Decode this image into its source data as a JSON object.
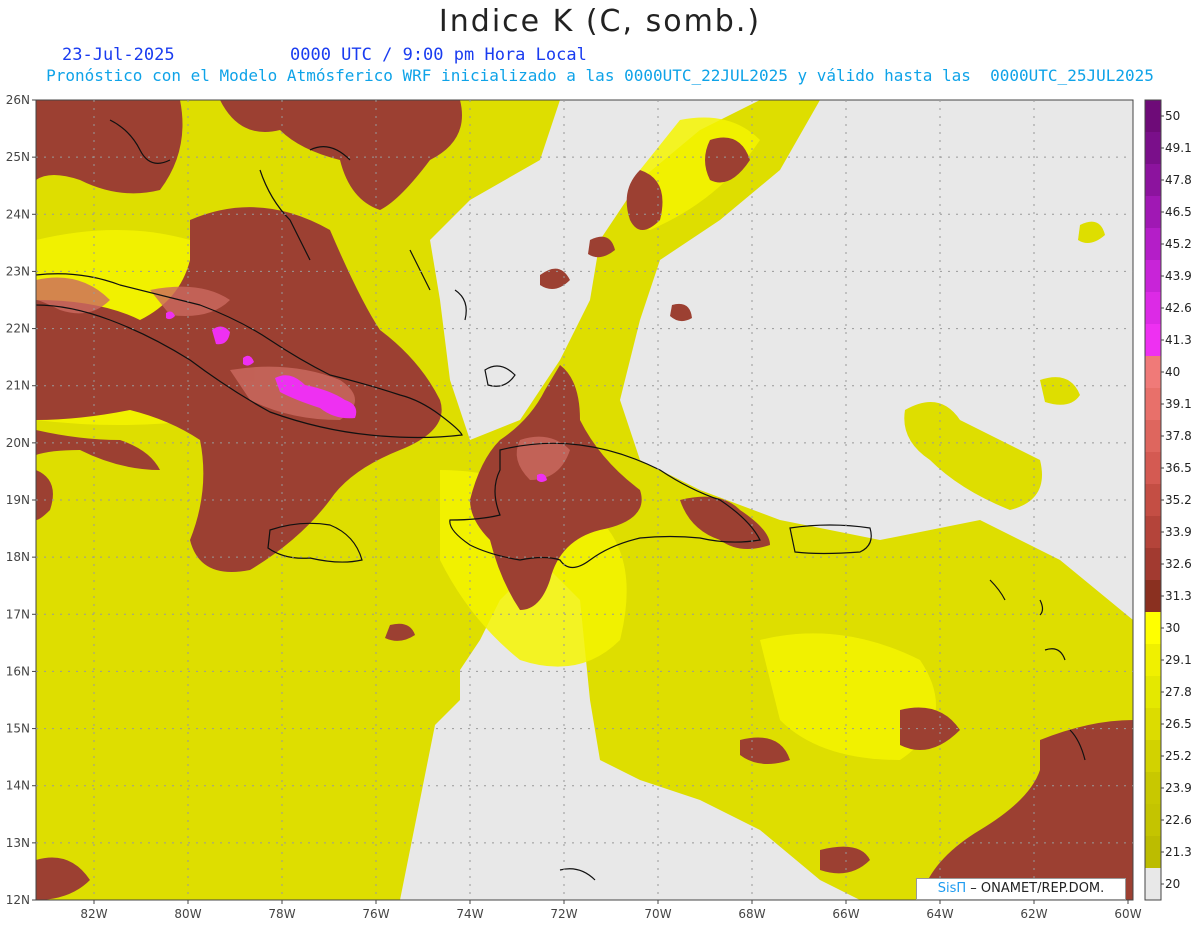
{
  "header": {
    "title": "Indice K (C, somb.)",
    "date": "23-Jul-2025",
    "time": "0000 UTC / 9:00 pm Hora Local",
    "subtitle": "Pronóstico con el Modelo Atmósferico WRF inicializado a las 0000UTC_22JUL2025 y válido hasta las  0000UTC_25JUL2025"
  },
  "axes": {
    "lat_labels": [
      "26N",
      "25N",
      "24N",
      "23N",
      "22N",
      "21N",
      "20N",
      "19N",
      "18N",
      "17N",
      "16N",
      "15N",
      "14N",
      "13N",
      "12N"
    ],
    "lon_labels": [
      "82W",
      "80W",
      "78W",
      "76W",
      "74W",
      "72W",
      "70W",
      "68W",
      "66W",
      "64W",
      "62W",
      "60W"
    ]
  },
  "colorbar": {
    "labels": [
      "50",
      "49.1",
      "47.8",
      "46.5",
      "45.2",
      "43.9",
      "42.6",
      "41.3",
      "40",
      "39.1",
      "37.8",
      "36.5",
      "35.2",
      "33.9",
      "32.6",
      "31.3",
      "30",
      "29.1",
      "27.8",
      "26.5",
      "25.2",
      "23.9",
      "22.6",
      "21.3",
      "20"
    ],
    "colors": [
      "#6e0b78",
      "#7a0f8a",
      "#8c139e",
      "#a018b4",
      "#b41ec8",
      "#c824d8",
      "#dc2ae6",
      "#ee30f2",
      "#f07a78",
      "#e8706a",
      "#de665e",
      "#d45a52",
      "#c44e44",
      "#b4443a",
      "#a23a30",
      "#8a3020",
      "#ffff00",
      "#f0f000",
      "#e4e800",
      "#dcdc00",
      "#d2d200",
      "#c8c800",
      "#c4c400",
      "#bcbc00",
      "#e8e8e8"
    ]
  },
  "credit": {
    "brand": "SisΠ",
    "text": " – ONAMET/REP.DOM."
  }
}
